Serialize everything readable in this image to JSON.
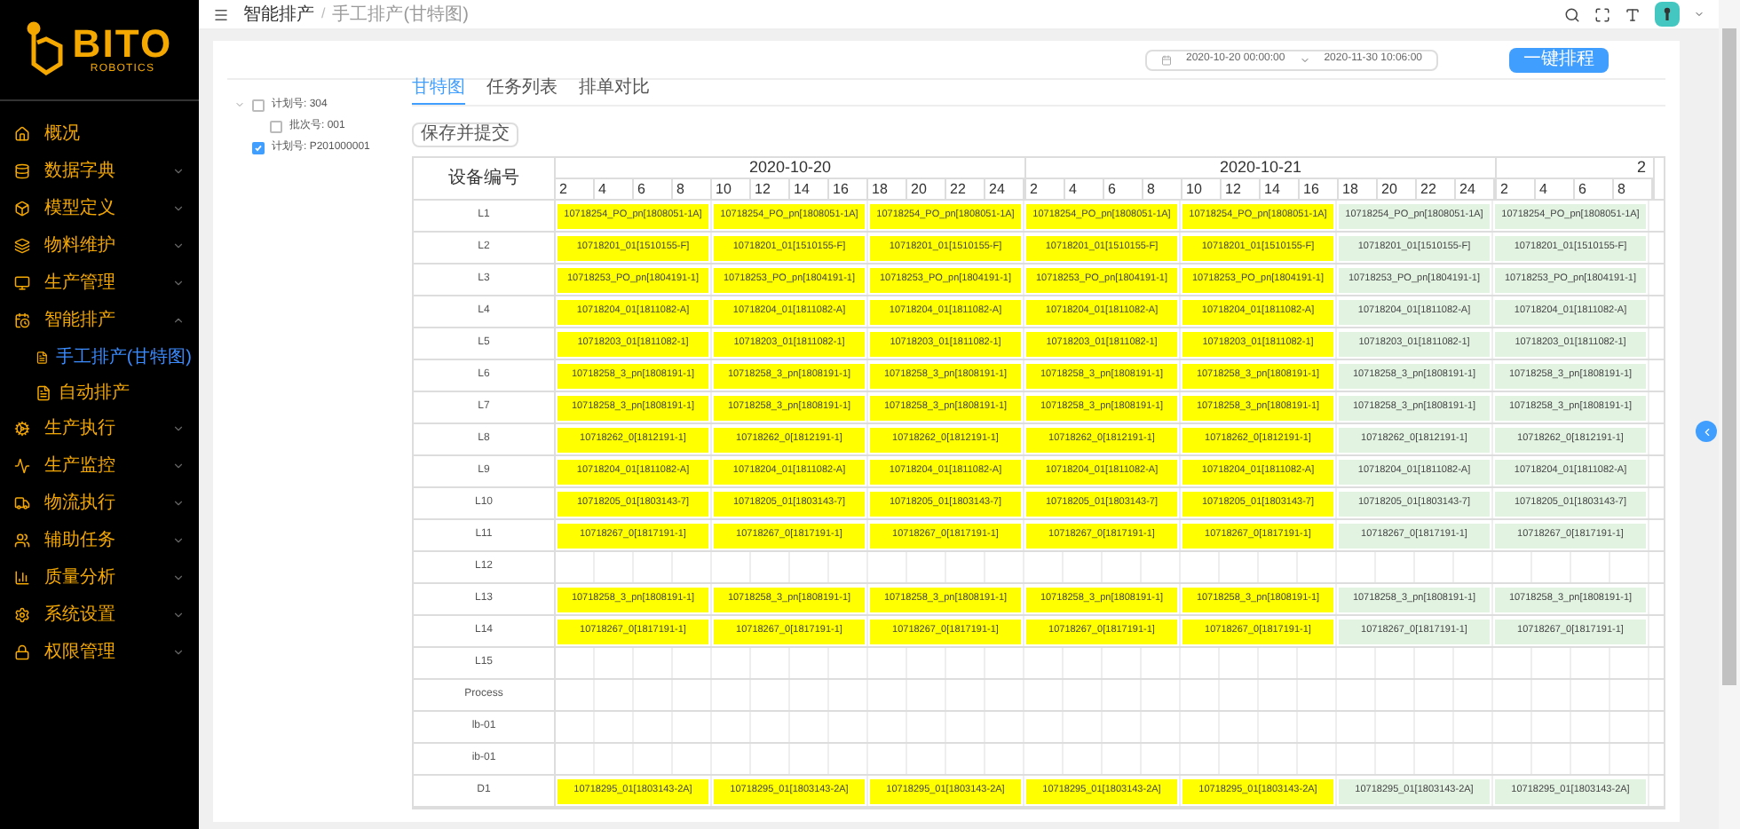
{
  "logo": {
    "name": "BITO",
    "tagline": "ROBOTICS"
  },
  "sidebar": {
    "items": [
      {
        "label": "概况"
      },
      {
        "label": "数据字典",
        "expanded": false
      },
      {
        "label": "模型定义",
        "expanded": false
      },
      {
        "label": "物料维护",
        "expanded": false
      },
      {
        "label": "生产管理",
        "expanded": false
      },
      {
        "label": "智能排产",
        "expanded": true,
        "children": [
          {
            "label": "手工排产(甘特图)",
            "selected": true
          },
          {
            "label": "自动排产",
            "selected": false
          }
        ]
      },
      {
        "label": "生产执行",
        "expanded": false
      },
      {
        "label": "生产监控",
        "expanded": false
      },
      {
        "label": "物流执行",
        "expanded": false
      },
      {
        "label": "辅助任务",
        "expanded": false
      },
      {
        "label": "质量分析",
        "expanded": false
      },
      {
        "label": "系统设置",
        "expanded": false
      },
      {
        "label": "权限管理",
        "expanded": false
      }
    ]
  },
  "breadcrumb": {
    "items": [
      "智能排产",
      "手工排产(甘特图)"
    ],
    "separator": "/"
  },
  "date_range": {
    "start": "2020-10-20 00:00:00",
    "end": "2020-11-30 10:06:00"
  },
  "schedule_button": "一键排程",
  "tree": [
    {
      "label": "计划号: 304",
      "checked": false,
      "expanded": true,
      "children": [
        {
          "label": "批次号: 001",
          "checked": false
        }
      ]
    },
    {
      "label": "计划号: P201000001",
      "checked": true
    }
  ],
  "tabs": [
    {
      "label": "甘特图",
      "selected": true
    },
    {
      "label": "任务列表",
      "selected": false
    },
    {
      "label": "排单对比",
      "selected": false
    }
  ],
  "save_button": "保存并提交",
  "gantt": {
    "corner": "设备编号",
    "days": [
      {
        "label": "2020-10-20",
        "hours": [
          "2",
          "4",
          "6",
          "8",
          "10",
          "12",
          "14",
          "16",
          "18",
          "20",
          "22",
          "24"
        ]
      },
      {
        "label": "2020-10-21",
        "hours": [
          "2",
          "4",
          "6",
          "8",
          "10",
          "12",
          "14",
          "16",
          "18",
          "20",
          "22",
          "24"
        ]
      },
      {
        "label": "2",
        "hours": [
          "2",
          "4",
          "6",
          "8"
        ]
      }
    ],
    "rows": [
      {
        "label": "L1",
        "bars": [
          {
            "label": "10718254_PO_pn[1808051-1A]",
            "color": "#ffff00"
          },
          {
            "label": "10718254_PO_pn[1808051-1A]",
            "color": "#ffff00"
          },
          {
            "label": "10718254_PO_pn[1808051-1A]",
            "color": "#ffff00"
          },
          {
            "label": "10718254_PO_pn[1808051-1A]",
            "color": "#ffff00"
          },
          {
            "label": "10718254_PO_pn[1808051-1A]",
            "color": "#ffff00"
          },
          {
            "label": "10718254_PO_pn[1808051-1A]",
            "color": "#e2f3e2"
          },
          {
            "label": "10718254_PO_pn[1808051-1A]",
            "color": "#e2f3e2"
          }
        ]
      },
      {
        "label": "L2",
        "bars": [
          {
            "label": "10718201_01[1510155-F]",
            "color": "#ffff00"
          },
          {
            "label": "10718201_01[1510155-F]",
            "color": "#ffff00"
          },
          {
            "label": "10718201_01[1510155-F]",
            "color": "#ffff00"
          },
          {
            "label": "10718201_01[1510155-F]",
            "color": "#ffff00"
          },
          {
            "label": "10718201_01[1510155-F]",
            "color": "#ffff00"
          },
          {
            "label": "10718201_01[1510155-F]",
            "color": "#e2f3e2"
          },
          {
            "label": "10718201_01[1510155-F]",
            "color": "#e2f3e2"
          }
        ]
      },
      {
        "label": "L3",
        "bars": [
          {
            "label": "10718253_PO_pn[1804191-1]",
            "color": "#ffff00"
          },
          {
            "label": "10718253_PO_pn[1804191-1]",
            "color": "#ffff00"
          },
          {
            "label": "10718253_PO_pn[1804191-1]",
            "color": "#ffff00"
          },
          {
            "label": "10718253_PO_pn[1804191-1]",
            "color": "#ffff00"
          },
          {
            "label": "10718253_PO_pn[1804191-1]",
            "color": "#ffff00"
          },
          {
            "label": "10718253_PO_pn[1804191-1]",
            "color": "#e2f3e2"
          },
          {
            "label": "10718253_PO_pn[1804191-1]",
            "color": "#e2f3e2"
          }
        ]
      },
      {
        "label": "L4",
        "bars": [
          {
            "label": "10718204_01[1811082-A]",
            "color": "#ffff00"
          },
          {
            "label": "10718204_01[1811082-A]",
            "color": "#ffff00"
          },
          {
            "label": "10718204_01[1811082-A]",
            "color": "#ffff00"
          },
          {
            "label": "10718204_01[1811082-A]",
            "color": "#ffff00"
          },
          {
            "label": "10718204_01[1811082-A]",
            "color": "#ffff00"
          },
          {
            "label": "10718204_01[1811082-A]",
            "color": "#e2f3e2"
          },
          {
            "label": "10718204_01[1811082-A]",
            "color": "#e2f3e2"
          }
        ]
      },
      {
        "label": "L5",
        "bars": [
          {
            "label": "10718203_01[1811082-1]",
            "color": "#ffff00"
          },
          {
            "label": "10718203_01[1811082-1]",
            "color": "#ffff00"
          },
          {
            "label": "10718203_01[1811082-1]",
            "color": "#ffff00"
          },
          {
            "label": "10718203_01[1811082-1]",
            "color": "#ffff00"
          },
          {
            "label": "10718203_01[1811082-1]",
            "color": "#ffff00"
          },
          {
            "label": "10718203_01[1811082-1]",
            "color": "#e2f3e2"
          },
          {
            "label": "10718203_01[1811082-1]",
            "color": "#e2f3e2"
          }
        ]
      },
      {
        "label": "L6",
        "bars": [
          {
            "label": "10718258_3_pn[1808191-1]",
            "color": "#ffff00"
          },
          {
            "label": "10718258_3_pn[1808191-1]",
            "color": "#ffff00"
          },
          {
            "label": "10718258_3_pn[1808191-1]",
            "color": "#ffff00"
          },
          {
            "label": "10718258_3_pn[1808191-1]",
            "color": "#ffff00"
          },
          {
            "label": "10718258_3_pn[1808191-1]",
            "color": "#ffff00"
          },
          {
            "label": "10718258_3_pn[1808191-1]",
            "color": "#e2f3e2"
          },
          {
            "label": "10718258_3_pn[1808191-1]",
            "color": "#e2f3e2"
          }
        ]
      },
      {
        "label": "L7",
        "bars": [
          {
            "label": "10718258_3_pn[1808191-1]",
            "color": "#ffff00"
          },
          {
            "label": "10718258_3_pn[1808191-1]",
            "color": "#ffff00"
          },
          {
            "label": "10718258_3_pn[1808191-1]",
            "color": "#ffff00"
          },
          {
            "label": "10718258_3_pn[1808191-1]",
            "color": "#ffff00"
          },
          {
            "label": "10718258_3_pn[1808191-1]",
            "color": "#ffff00"
          },
          {
            "label": "10718258_3_pn[1808191-1]",
            "color": "#e2f3e2"
          },
          {
            "label": "10718258_3_pn[1808191-1]",
            "color": "#e2f3e2"
          }
        ]
      },
      {
        "label": "L8",
        "bars": [
          {
            "label": "10718262_0[1812191-1]",
            "color": "#ffff00"
          },
          {
            "label": "10718262_0[1812191-1]",
            "color": "#ffff00"
          },
          {
            "label": "10718262_0[1812191-1]",
            "color": "#ffff00"
          },
          {
            "label": "10718262_0[1812191-1]",
            "color": "#ffff00"
          },
          {
            "label": "10718262_0[1812191-1]",
            "color": "#ffff00"
          },
          {
            "label": "10718262_0[1812191-1]",
            "color": "#e2f3e2"
          },
          {
            "label": "10718262_0[1812191-1]",
            "color": "#e2f3e2"
          }
        ]
      },
      {
        "label": "L9",
        "bars": [
          {
            "label": "10718204_01[1811082-A]",
            "color": "#ffff00"
          },
          {
            "label": "10718204_01[1811082-A]",
            "color": "#ffff00"
          },
          {
            "label": "10718204_01[1811082-A]",
            "color": "#ffff00"
          },
          {
            "label": "10718204_01[1811082-A]",
            "color": "#ffff00"
          },
          {
            "label": "10718204_01[1811082-A]",
            "color": "#ffff00"
          },
          {
            "label": "10718204_01[1811082-A]",
            "color": "#e2f3e2"
          },
          {
            "label": "10718204_01[1811082-A]",
            "color": "#e2f3e2"
          }
        ]
      },
      {
        "label": "L10",
        "bars": [
          {
            "label": "10718205_01[1803143-7]",
            "color": "#ffff00"
          },
          {
            "label": "10718205_01[1803143-7]",
            "color": "#ffff00"
          },
          {
            "label": "10718205_01[1803143-7]",
            "color": "#ffff00"
          },
          {
            "label": "10718205_01[1803143-7]",
            "color": "#ffff00"
          },
          {
            "label": "10718205_01[1803143-7]",
            "color": "#ffff00"
          },
          {
            "label": "10718205_01[1803143-7]",
            "color": "#e2f3e2"
          },
          {
            "label": "10718205_01[1803143-7]",
            "color": "#e2f3e2"
          }
        ]
      },
      {
        "label": "L11",
        "bars": [
          {
            "label": "10718267_0[1817191-1]",
            "color": "#ffff00"
          },
          {
            "label": "10718267_0[1817191-1]",
            "color": "#ffff00"
          },
          {
            "label": "10718267_0[1817191-1]",
            "color": "#ffff00"
          },
          {
            "label": "10718267_0[1817191-1]",
            "color": "#ffff00"
          },
          {
            "label": "10718267_0[1817191-1]",
            "color": "#ffff00"
          },
          {
            "label": "10718267_0[1817191-1]",
            "color": "#e2f3e2"
          },
          {
            "label": "10718267_0[1817191-1]",
            "color": "#e2f3e2"
          }
        ]
      },
      {
        "label": "L12"
      },
      {
        "label": "L13",
        "bars": [
          {
            "label": "10718258_3_pn[1808191-1]",
            "color": "#ffff00"
          },
          {
            "label": "10718258_3_pn[1808191-1]",
            "color": "#ffff00"
          },
          {
            "label": "10718258_3_pn[1808191-1]",
            "color": "#ffff00"
          },
          {
            "label": "10718258_3_pn[1808191-1]",
            "color": "#ffff00"
          },
          {
            "label": "10718258_3_pn[1808191-1]",
            "color": "#ffff00"
          },
          {
            "label": "10718258_3_pn[1808191-1]",
            "color": "#e2f3e2"
          },
          {
            "label": "10718258_3_pn[1808191-1]",
            "color": "#e2f3e2"
          }
        ]
      },
      {
        "label": "L14",
        "bars": [
          {
            "label": "10718267_0[1817191-1]",
            "color": "#ffff00"
          },
          {
            "label": "10718267_0[1817191-1]",
            "color": "#ffff00"
          },
          {
            "label": "10718267_0[1817191-1]",
            "color": "#ffff00"
          },
          {
            "label": "10718267_0[1817191-1]",
            "color": "#ffff00"
          },
          {
            "label": "10718267_0[1817191-1]",
            "color": "#ffff00"
          },
          {
            "label": "10718267_0[1817191-1]",
            "color": "#e2f3e2"
          },
          {
            "label": "10718267_0[1817191-1]",
            "color": "#e2f3e2"
          }
        ]
      },
      {
        "label": "L15"
      },
      {
        "label": "Process"
      },
      {
        "label": "lb-01"
      },
      {
        "label": "ib-01"
      },
      {
        "label": "D1",
        "bars": [
          {
            "label": "10718295_01[1803143-2A]",
            "color": "#ffff00"
          },
          {
            "label": "10718295_01[1803143-2A]",
            "color": "#ffff00"
          },
          {
            "label": "10718295_01[1803143-2A]",
            "color": "#ffff00"
          },
          {
            "label": "10718295_01[1803143-2A]",
            "color": "#ffff00"
          },
          {
            "label": "10718295_01[1803143-2A]",
            "color": "#ffff00"
          },
          {
            "label": "10718295_01[1803143-2A]",
            "color": "#e2f3e2"
          },
          {
            "label": "10718295_01[1803143-2A]",
            "color": "#e2f3e2"
          }
        ]
      }
    ]
  }
}
